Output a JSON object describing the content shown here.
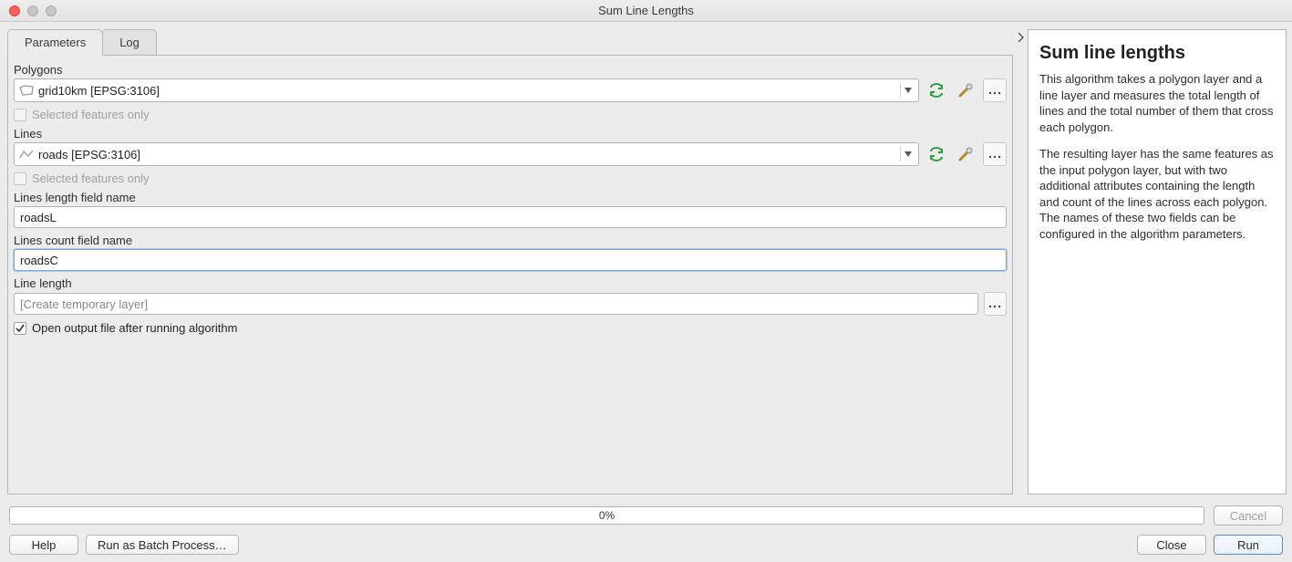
{
  "window": {
    "title": "Sum Line Lengths"
  },
  "tabs": {
    "parameters": "Parameters",
    "log": "Log"
  },
  "labels": {
    "polygons": "Polygons",
    "lines": "Lines",
    "selected_only": "Selected features only",
    "lines_length_field": "Lines length field name",
    "lines_count_field": "Lines count field name",
    "output": "Line length",
    "open_after": "Open output file after running algorithm"
  },
  "values": {
    "polygons_layer": "grid10km [EPSG:3106]",
    "lines_layer": "roads [EPSG:3106]",
    "length_field": "roadsL",
    "count_field": "roadsC",
    "output_placeholder": "[Create temporary layer]",
    "open_after_checked": true
  },
  "progress": {
    "text": "0%"
  },
  "buttons": {
    "help": "Help",
    "batch": "Run as Batch Process…",
    "cancel": "Cancel",
    "close": "Close",
    "run": "Run"
  },
  "help": {
    "title": "Sum line lengths",
    "p1": "This algorithm takes a polygon layer and a line layer and measures the total length of lines and the total number of them that cross each polygon.",
    "p2": "The resulting layer has the same features as the input polygon layer, but with two additional attributes containing the length and count of the lines across each polygon. The names of these two fields can be configured in the algorithm parameters."
  }
}
